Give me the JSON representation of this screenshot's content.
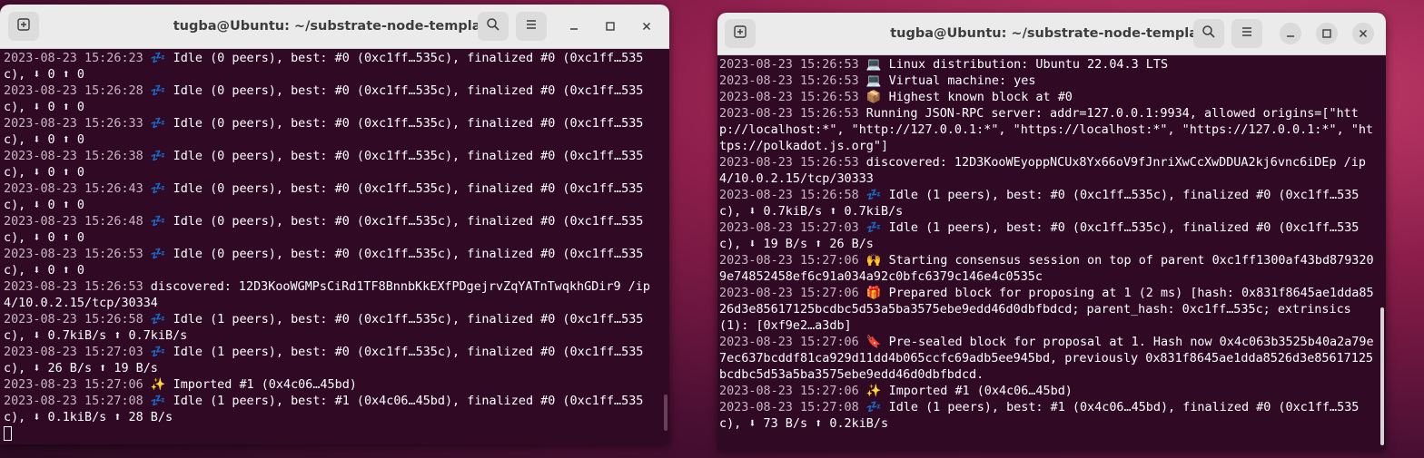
{
  "left_window": {
    "title": "tugba@Ubuntu: ~/substrate-node-template",
    "icons": [
      "new-tab-icon",
      "search-icon",
      "hamburger-menu-icon",
      "minimize-icon",
      "maximize-icon",
      "close-icon"
    ],
    "lines": [
      {
        "ts": "2023-08-23 15:26:23",
        "text": " 💤 Idle (0 peers), best: #0 (0xc1ff…535c), finalized #0 (0xc1ff…535c), ⬇ 0 ⬆ 0"
      },
      {
        "ts": "2023-08-23 15:26:28",
        "text": " 💤 Idle (0 peers), best: #0 (0xc1ff…535c), finalized #0 (0xc1ff…535c), ⬇ 0 ⬆ 0"
      },
      {
        "ts": "2023-08-23 15:26:33",
        "text": " 💤 Idle (0 peers), best: #0 (0xc1ff…535c), finalized #0 (0xc1ff…535c), ⬇ 0 ⬆ 0"
      },
      {
        "ts": "2023-08-23 15:26:38",
        "text": " 💤 Idle (0 peers), best: #0 (0xc1ff…535c), finalized #0 (0xc1ff…535c), ⬇ 0 ⬆ 0"
      },
      {
        "ts": "2023-08-23 15:26:43",
        "text": " 💤 Idle (0 peers), best: #0 (0xc1ff…535c), finalized #0 (0xc1ff…535c), ⬇ 0 ⬆ 0"
      },
      {
        "ts": "2023-08-23 15:26:48",
        "text": " 💤 Idle (0 peers), best: #0 (0xc1ff…535c), finalized #0 (0xc1ff…535c), ⬇ 0 ⬆ 0"
      },
      {
        "ts": "2023-08-23 15:26:53",
        "text": " 💤 Idle (0 peers), best: #0 (0xc1ff…535c), finalized #0 (0xc1ff…535c), ⬇ 0 ⬆ 0"
      },
      {
        "ts": "2023-08-23 15:26:53",
        "text": " discovered: 12D3KooWGMPsCiRd1TF8BnnbKkEXfPDgejrvZqYATnTwqkhGDir9 /ip4/10.0.2.15/tcp/30334"
      },
      {
        "ts": "2023-08-23 15:26:58",
        "text": " 💤 Idle (1 peers), best: #0 (0xc1ff…535c), finalized #0 (0xc1ff…535c), ⬇ 0.7kiB/s ⬆ 0.7kiB/s"
      },
      {
        "ts": "2023-08-23 15:27:03",
        "text": " 💤 Idle (1 peers), best: #0 (0xc1ff…535c), finalized #0 (0xc1ff…535c), ⬇ 26 B/s ⬆ 19 B/s"
      },
      {
        "ts": "2023-08-23 15:27:06",
        "text": " ✨ Imported #1 (0x4c06…45bd)"
      },
      {
        "ts": "2023-08-23 15:27:08",
        "text": " 💤 Idle (1 peers), best: #1 (0x4c06…45bd), finalized #0 (0xc1ff…535c), ⬇ 0.1kiB/s ⬆ 28 B/s"
      }
    ]
  },
  "right_window": {
    "title": "tugba@Ubuntu: ~/substrate-node-template",
    "icons": [
      "new-tab-icon",
      "search-icon",
      "hamburger-menu-icon",
      "minimize-icon",
      "maximize-icon",
      "close-icon"
    ],
    "lines": [
      {
        "ts": "2023-08-23 15:26:53",
        "text": " 💻 Linux distribution: Ubuntu 22.04.3 LTS"
      },
      {
        "ts": "2023-08-23 15:26:53",
        "text": " 💻 Virtual machine: yes"
      },
      {
        "ts": "2023-08-23 15:26:53",
        "text": " 📦 Highest known block at #0"
      },
      {
        "ts": "2023-08-23 15:26:53",
        "text": " Running JSON-RPC server: addr=127.0.0.1:9934, allowed origins=[\"http://localhost:*\", \"http://127.0.0.1:*\", \"https://localhost:*\", \"https://127.0.0.1:*\", \"https://polkadot.js.org\"]"
      },
      {
        "ts": "2023-08-23 15:26:53",
        "text": " discovered: 12D3KooWEyoppNCUx8Yx66oV9fJnriXwCcXwDDUA2kj6vnc6iDEp /ip4/10.0.2.15/tcp/30333"
      },
      {
        "ts": "2023-08-23 15:26:58",
        "text": " 💤 Idle (1 peers), best: #0 (0xc1ff…535c), finalized #0 (0xc1ff…535c), ⬇ 0.7kiB/s ⬆ 0.7kiB/s"
      },
      {
        "ts": "2023-08-23 15:27:03",
        "text": " 💤 Idle (1 peers), best: #0 (0xc1ff…535c), finalized #0 (0xc1ff…535c), ⬇ 19 B/s ⬆ 26 B/s"
      },
      {
        "ts": "2023-08-23 15:27:06",
        "text": " 🙌 Starting consensus session on top of parent 0xc1ff1300af43bd8793209e74852458ef6c91a034a92c0bfc6379c146e4c0535c"
      },
      {
        "ts": "2023-08-23 15:27:06",
        "text": " 🎁 Prepared block for proposing at 1 (2 ms) [hash: 0x831f8645ae1dda8526d3e85617125bcdbc5d53a5ba3575ebe9edd46d0dbfbdcd; parent_hash: 0xc1ff…535c; extrinsics (1): [0xf9e2…a3db]"
      },
      {
        "ts": "2023-08-23 15:27:06",
        "text": " 🔖 Pre-sealed block for proposal at 1. Hash now 0x4c063b3525b40a2a79e7ec637bcddf81ca929d11dd4b065ccfc69adb5ee945bd, previously 0x831f8645ae1dda8526d3e85617125bcdbc5d53a5ba3575ebe9edd46d0dbfbdcd."
      },
      {
        "ts": "2023-08-23 15:27:06",
        "text": " ✨ Imported #1 (0x4c06…45bd)"
      },
      {
        "ts": "2023-08-23 15:27:08",
        "text": " 💤 Idle (1 peers), best: #1 (0x4c06…45bd), finalized #0 (0xc1ff…535c), ⬇ 73 B/s ⬆ 0.2kiB/s"
      }
    ]
  },
  "colors": {
    "terminal_bg": "#300a24",
    "titlebar_bg": "#ebebeb",
    "timestamp": "#c7b6c1",
    "text": "#ffffff"
  }
}
